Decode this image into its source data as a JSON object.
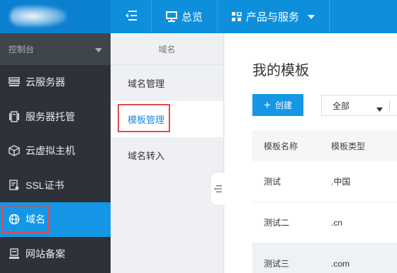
{
  "topbar": {
    "overview_label": "总览",
    "products_label": "产品与服务"
  },
  "sidebar": {
    "header_label": "控制台",
    "items": [
      {
        "label": "云服务器",
        "icon": "server-icon"
      },
      {
        "label": "服务器托管",
        "icon": "hosting-icon"
      },
      {
        "label": "云虚拟主机",
        "icon": "cube-icon"
      },
      {
        "label": "SSL证书",
        "icon": "certificate-icon"
      },
      {
        "label": "域名",
        "icon": "globe-icon",
        "active": true
      },
      {
        "label": "网站备案",
        "icon": "filing-icon"
      }
    ]
  },
  "submenu": {
    "title": "域名",
    "items": [
      {
        "label": "域名管理"
      },
      {
        "label": "模板管理",
        "active": true
      },
      {
        "label": "域名转入"
      }
    ]
  },
  "main": {
    "title": "我的模板",
    "create_label": "创建",
    "filter_value": "全部",
    "table": {
      "columns": [
        "模板名称",
        "模板类型"
      ],
      "rows": [
        [
          "测试",
          ".中国"
        ],
        [
          "测试二",
          ".cn"
        ],
        [
          "测试三",
          ".com"
        ]
      ]
    }
  },
  "colors": {
    "brand_blue": "#0e8fdc",
    "active_blue": "#1596e6",
    "sidebar_dark": "#2c3237",
    "highlight_red": "#e34a4a"
  }
}
